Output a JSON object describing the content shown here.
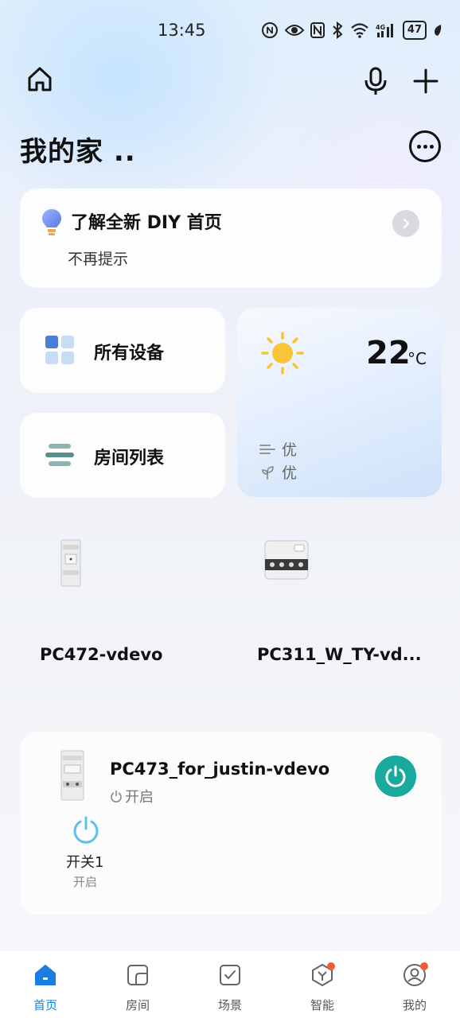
{
  "status_bar": {
    "time": "13:45",
    "battery": "47",
    "icons": [
      "nfc-icon",
      "eye-icon",
      "n-icon",
      "bluetooth-icon",
      "wifi-icon",
      "signal-4g-icon",
      "battery-icon",
      "leaf-icon"
    ]
  },
  "header": {
    "title": "我的家 .."
  },
  "tip_card": {
    "title": "了解全新 DIY 首页",
    "dismiss": "不再提示"
  },
  "quick": {
    "devices_label": "所有设备",
    "rooms_label": "房间列表"
  },
  "weather": {
    "temperature": "22",
    "unit": "°C",
    "air_quality": "优",
    "humidity_quality": "优"
  },
  "devices": [
    {
      "name": "PC472-vdevo"
    },
    {
      "name": "PC311_W_TY-vd..."
    }
  ],
  "wide_device": {
    "name": "PC473_for_justin-vdevo",
    "status": "开启",
    "switch_label": "开关1",
    "switch_state": "开启"
  },
  "tabbar": {
    "tabs": [
      {
        "label": "首页"
      },
      {
        "label": "房间"
      },
      {
        "label": "场景"
      },
      {
        "label": "智能"
      },
      {
        "label": "我的"
      }
    ]
  },
  "colors": {
    "accent": "#1a7de0",
    "power_teal": "#1aa99d",
    "badge": "#f25b3a"
  }
}
